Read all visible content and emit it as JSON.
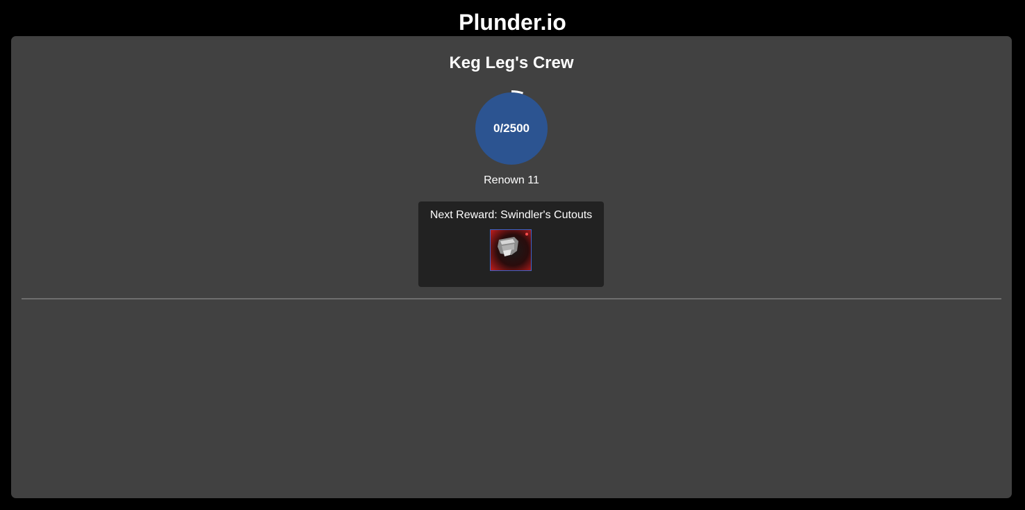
{
  "header": {
    "app_title": "Plunder.io"
  },
  "crew": {
    "title": "Keg Leg's Crew",
    "progress": {
      "current": 0,
      "max": 2500,
      "label": "0/2500",
      "fill_color": "#2c5491",
      "ring_color": "#ffffff"
    },
    "renown_label": "Renown 11"
  },
  "reward": {
    "label": "Next Reward: Swindler's Cutouts",
    "item_icon": "cutouts-reward-icon",
    "item_border_color": "#3f63c9"
  },
  "colors": {
    "background": "#000000",
    "panel": "#414141",
    "card": "#222222"
  }
}
